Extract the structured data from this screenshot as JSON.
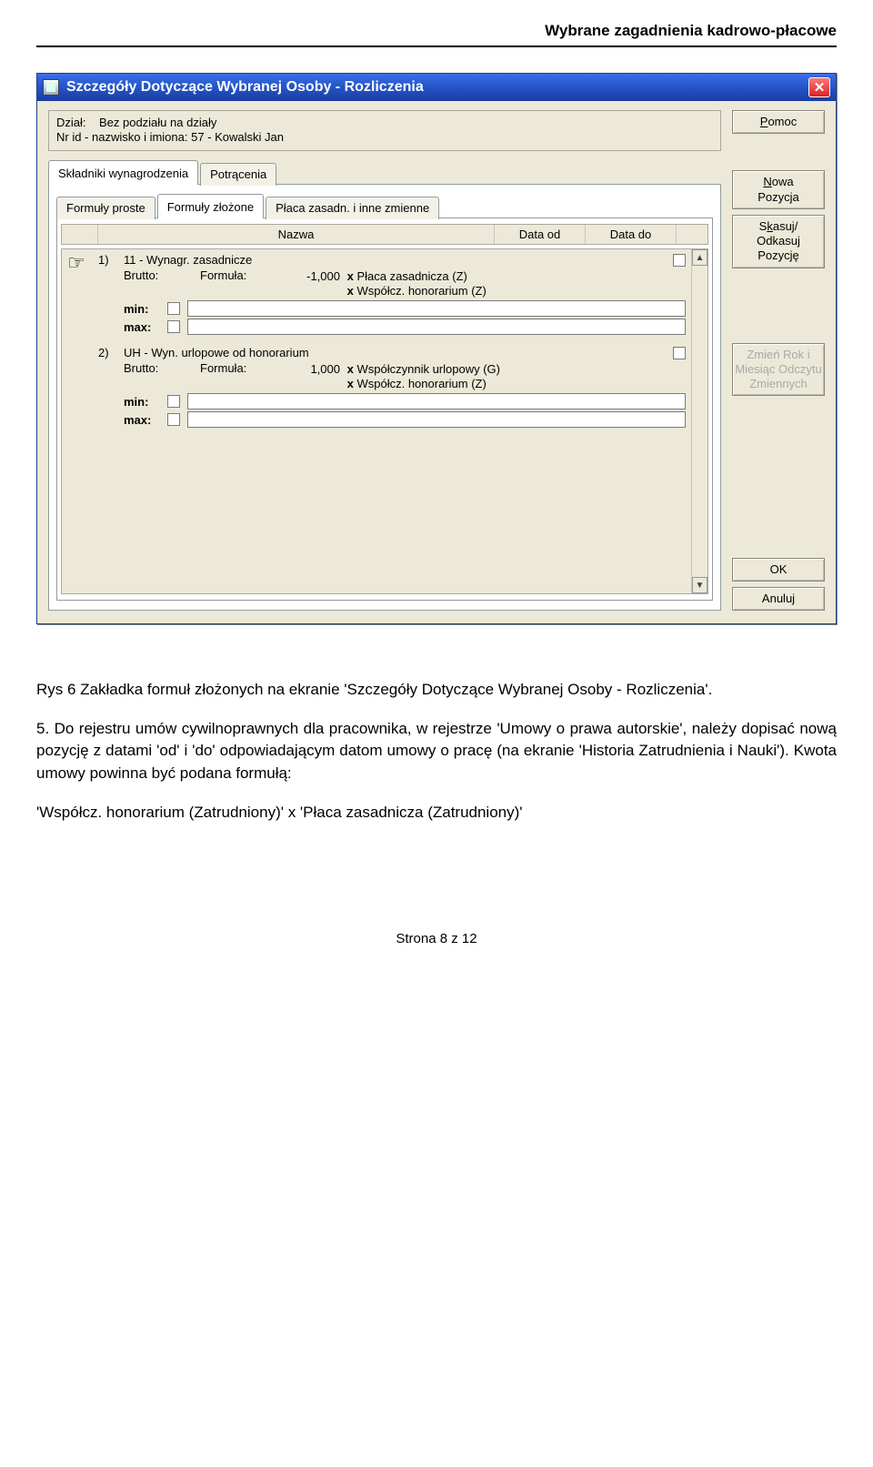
{
  "doc_header": "Wybrane zagadnienia kadrowo-płacowe",
  "window": {
    "title": "Szczegóły Dotyczące Wybranej Osoby - Rozliczenia",
    "info": {
      "dzial_label": "Dział:",
      "dzial_value": "Bez podziału na działy",
      "id_label": "Nr id - nazwisko i imiona:",
      "id_value": "57 - Kowalski Jan"
    },
    "side_buttons": {
      "pomoc": "Pomoc",
      "nowa": "Nowa Pozycja",
      "skasuj": "Skasuj/ Odkasuj Pozycję",
      "zmien": "Zmień Rok i Miesiąc Odczytu Zmiennych",
      "ok": "OK",
      "anuluj": "Anuluj"
    },
    "tabs_outer": [
      {
        "label": "Składniki wynagrodzenia",
        "active": true
      },
      {
        "label": "Potrącenia",
        "active": false
      }
    ],
    "tabs_inner": [
      {
        "label": "Formuły proste",
        "active": false
      },
      {
        "label": "Formuły złożone",
        "active": true
      },
      {
        "label": "Płaca zasadn. i inne zmienne",
        "active": false
      }
    ],
    "columns": {
      "nazwa": "Nazwa",
      "data_od": "Data od",
      "data_do": "Data do"
    },
    "items": [
      {
        "idx": "1)",
        "title": "11 - Wynagr. zasadnicze",
        "brutto_label": "Brutto:",
        "formula_label": "Formuła:",
        "lines": [
          {
            "num": "-1,000",
            "x": "x",
            "rest": "Płaca zasadnicza (Z)"
          },
          {
            "num": "",
            "x": "x",
            "rest": "Współcz. honorarium (Z)"
          }
        ],
        "min": "min:",
        "max": "max:"
      },
      {
        "idx": "2)",
        "title": "UH - Wyn. urlopowe od honorarium",
        "brutto_label": "Brutto:",
        "formula_label": "Formuła:",
        "lines": [
          {
            "num": "1,000",
            "x": "x",
            "rest": "Współczynnik urlopowy (G)"
          },
          {
            "num": "",
            "x": "x",
            "rest": "Współcz. honorarium (Z)"
          }
        ],
        "min": "min:",
        "max": "max:"
      }
    ]
  },
  "caption": "Rys 6 Zakładka formuł złożonych na ekranie 'Szczegóły Dotyczące Wybranej Osoby - Rozliczenia'.",
  "para": "5. Do rejestru umów cywilnoprawnych dla pracownika, w rejestrze 'Umowy o prawa autorskie', należy dopisać nową pozycję z datami 'od' i 'do' odpowiadającym datom umowy o pracę (na ekranie 'Historia Zatrudnienia i Nauki'). Kwota umowy powinna być podana formułą:",
  "formula_text": "'Współcz. honorarium (Zatrudniony)' x 'Płaca zasadnicza (Zatrudniony)'",
  "page_num": "Strona 8 z 12"
}
